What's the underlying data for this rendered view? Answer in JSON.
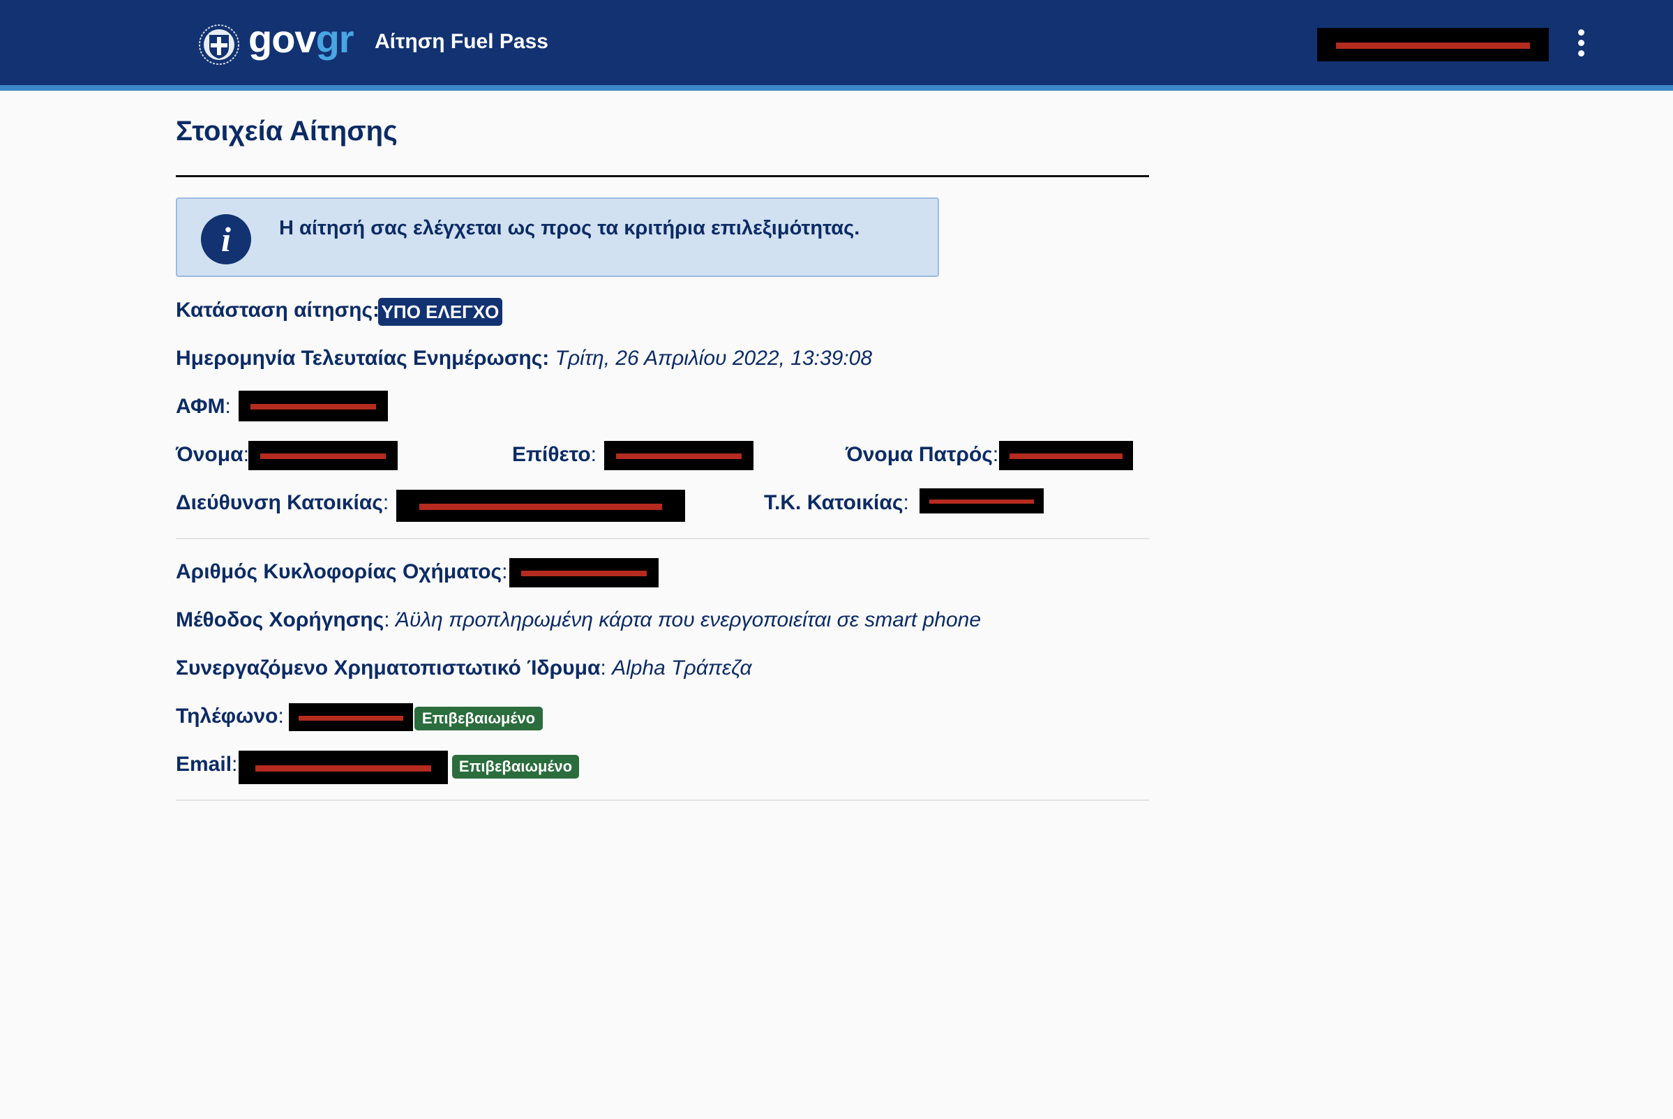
{
  "header": {
    "logo": {
      "gov": "gov",
      "gr": "gr",
      "emblem_icon": "greek-coat-of-arms-icon"
    },
    "service_name": "Αίτηση Fuel Pass",
    "user_menu_icon": "kebab-menu-icon",
    "colors": {
      "bar": "#123271",
      "accent_stripe": "#3d88c6",
      "logo_gr": "#4aa5e3"
    }
  },
  "page": {
    "title": "Στοιχεία Αίτησης",
    "info_message": "Η αίτησή σας ελέγχεται ως προς τα κριτήρια επιλεξιμότητας.",
    "info_icon": "info-icon"
  },
  "fields": {
    "status": {
      "label": "Κατάσταση αίτησης:",
      "badge": "ΥΠΟ ΕΛΕΓΧΟ"
    },
    "last_update": {
      "label": "Ημερομηνία Τελευταίας Ενημέρωσης:",
      "value": "Τρίτη, 26 Απριλίου 2022, 13:39:08"
    },
    "afm": {
      "label": "ΑΦΜ",
      "sep": ":"
    },
    "first_name": {
      "label": "Όνομα",
      "sep": ":"
    },
    "last_name": {
      "label": "Επίθετο",
      "sep": ":"
    },
    "father_name": {
      "label": "Όνομα Πατρός",
      "sep": ":"
    },
    "address": {
      "label": "Διεύθυνση Κατοικίας",
      "sep": ":"
    },
    "postal_code": {
      "label": "Τ.Κ. Κατοικίας",
      "sep": ":"
    },
    "plate": {
      "label": "Αριθμός Κυκλοφορίας Οχήματος",
      "sep": ":"
    },
    "method": {
      "label": "Μέθοδος Χορήγησης",
      "sep": ":",
      "value": "Άϋλη προπληρωμένη κάρτα που ενεργοποιείται σε smart phone"
    },
    "bank": {
      "label": "Συνεργαζόμενο Χρηματοπιστωτικό Ίδρυμα",
      "sep": ":",
      "value": "Alpha Τράπεζα"
    },
    "phone": {
      "label": "Τηλέφωνο",
      "sep": ":",
      "badge": "Επιβεβαιωμένο"
    },
    "email": {
      "label": "Email",
      "sep": ":",
      "badge": "Επιβεβαιωμένο"
    }
  },
  "colors": {
    "text": "#0c2b64",
    "status_badge": "#123271",
    "verified_badge": "#2b6d3d",
    "info_bg": "#d1e1f1",
    "redaction": "#000000",
    "redaction_stroke": "#b52b1f"
  }
}
